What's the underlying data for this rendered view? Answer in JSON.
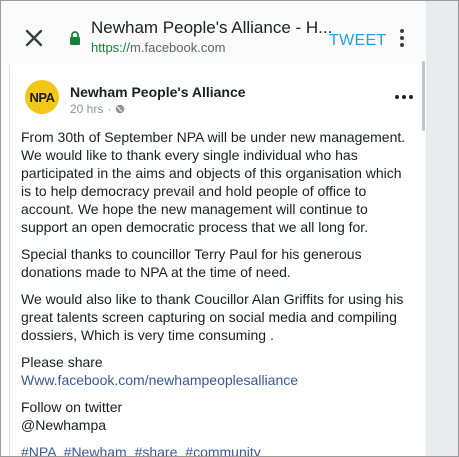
{
  "browser": {
    "title": "Newham People's Alliance - H...",
    "url_scheme": "https://",
    "url_host": "m.facebook.com",
    "tweet_label": "TWEET"
  },
  "post": {
    "avatar_text": "NPA",
    "page_name": "Newham People's Alliance",
    "time": "20 hrs",
    "separator": "·",
    "paragraph1": [
      "From 30th of September NPA will be under new management.",
      "We would like to thank every single individual who has",
      "participated in the aims and objects of this organisation which",
      "is to help democracy prevail and hold people of office to",
      "account. We hope the new management will continue to",
      "support an open democratic process that we all long for."
    ],
    "paragraph2": [
      "Special thanks to councillor Terry Paul for his generous",
      "donations made to NPA at the time of need."
    ],
    "paragraph3": [
      "We would also like to thank Coucillor Alan Griffits for using his",
      "great talents screen capturing on social media and compiling",
      "dossiers, Which is very time consuming ."
    ],
    "please_share": "Please share",
    "share_link": "Www.facebook.com/newhampeoplesalliance",
    "follow_text": "Follow on twitter",
    "twitter_handle": "@Newhampa",
    "hashtags": [
      "#NPA",
      "#Newham",
      "#share",
      "#community"
    ]
  },
  "colors": {
    "link": "#385898",
    "tweet": "#1da1f2",
    "avatar_bg": "#f3c617",
    "lock": "#188038"
  },
  "icons": [
    "close-icon",
    "lock-icon",
    "more-vert-icon",
    "globe-icon",
    "more-horiz-icon"
  ]
}
